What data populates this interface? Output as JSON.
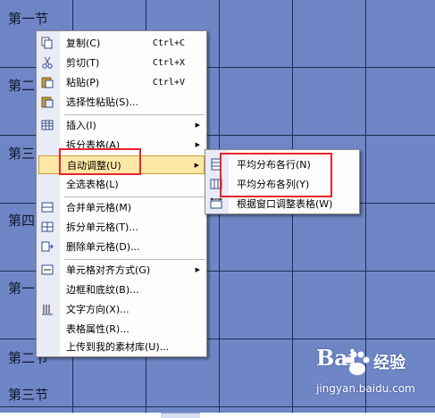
{
  "table": {
    "row_labels": [
      "第一节",
      "第二节",
      "第三节",
      "第四节",
      "第一节",
      "第二节",
      "第三节"
    ]
  },
  "context_menu": {
    "items": [
      {
        "label": "复制(C)",
        "shortcut": "Ctrl+C",
        "icon": "copy-icon"
      },
      {
        "label": "剪切(T)",
        "shortcut": "Ctrl+X",
        "icon": "scissors-icon"
      },
      {
        "label": "粘贴(P)",
        "shortcut": "Ctrl+V",
        "icon": "paste-icon"
      },
      {
        "label": "选择性粘贴(S)...",
        "icon": "paste-special-icon"
      },
      {
        "label": "插入(I)",
        "icon": "insert-table-icon",
        "submenu": true
      },
      {
        "label": "拆分表格(A)",
        "submenu": true
      },
      {
        "label": "自动调整(U)",
        "submenu": true,
        "active": true
      },
      {
        "label": "全选表格(L)"
      },
      {
        "label": "合并单元格(M)",
        "icon": "merge-cells-icon"
      },
      {
        "label": "拆分单元格(T)...",
        "icon": "split-cells-icon"
      },
      {
        "label": "删除单元格(D)...",
        "icon": "delete-cells-icon"
      },
      {
        "label": "单元格对齐方式(G)",
        "icon": "cell-align-icon",
        "submenu": true
      },
      {
        "label": "边框和底纹(B)..."
      },
      {
        "label": "文字方向(X)...",
        "icon": "text-direction-icon"
      },
      {
        "label": "表格属性(R)..."
      },
      {
        "label": "上传到我的素材库(U)..."
      }
    ]
  },
  "sub_menu": {
    "items": [
      {
        "label": "平均分布各行(N)",
        "icon": "distribute-rows-icon"
      },
      {
        "label": "平均分布各列(Y)",
        "icon": "distribute-columns-icon"
      },
      {
        "label": "根据窗口调整表格(W)",
        "icon": "autofit-window-icon"
      }
    ]
  },
  "watermark": {
    "logo": "Bai",
    "brand": "经验",
    "url": "jingyan.baidu.com"
  },
  "colors": {
    "table_bg": "#6f86c6",
    "grid": "#1e2b55",
    "highlight": "#ffe8a6",
    "annotation": "#e8242c"
  }
}
